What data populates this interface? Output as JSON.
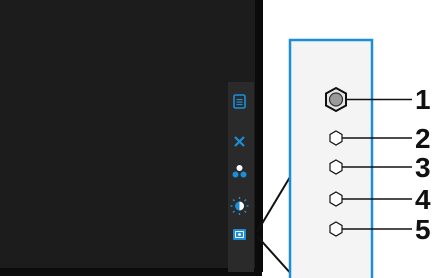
{
  "colors": {
    "screen": "#1c1c1c",
    "bezel": "#111111",
    "osd_strip": "#2a2a2a",
    "accent": "#1a8fd8",
    "callout_outline": "#1a8fd8",
    "callout_bg": "#f4f4f4",
    "leader_line": "#111111",
    "label": "#111111"
  },
  "osd_icons": [
    {
      "icon": "menu-icon"
    },
    {
      "icon": "close-icon"
    },
    {
      "icon": "color-icon"
    },
    {
      "icon": "brightness-icon"
    },
    {
      "icon": "input-source-icon",
      "highlighted": true
    }
  ],
  "buttons": [
    {
      "number": "1",
      "type": "joystick"
    },
    {
      "number": "2",
      "type": "button"
    },
    {
      "number": "3",
      "type": "button"
    },
    {
      "number": "4",
      "type": "button"
    },
    {
      "number": "5",
      "type": "button"
    }
  ]
}
